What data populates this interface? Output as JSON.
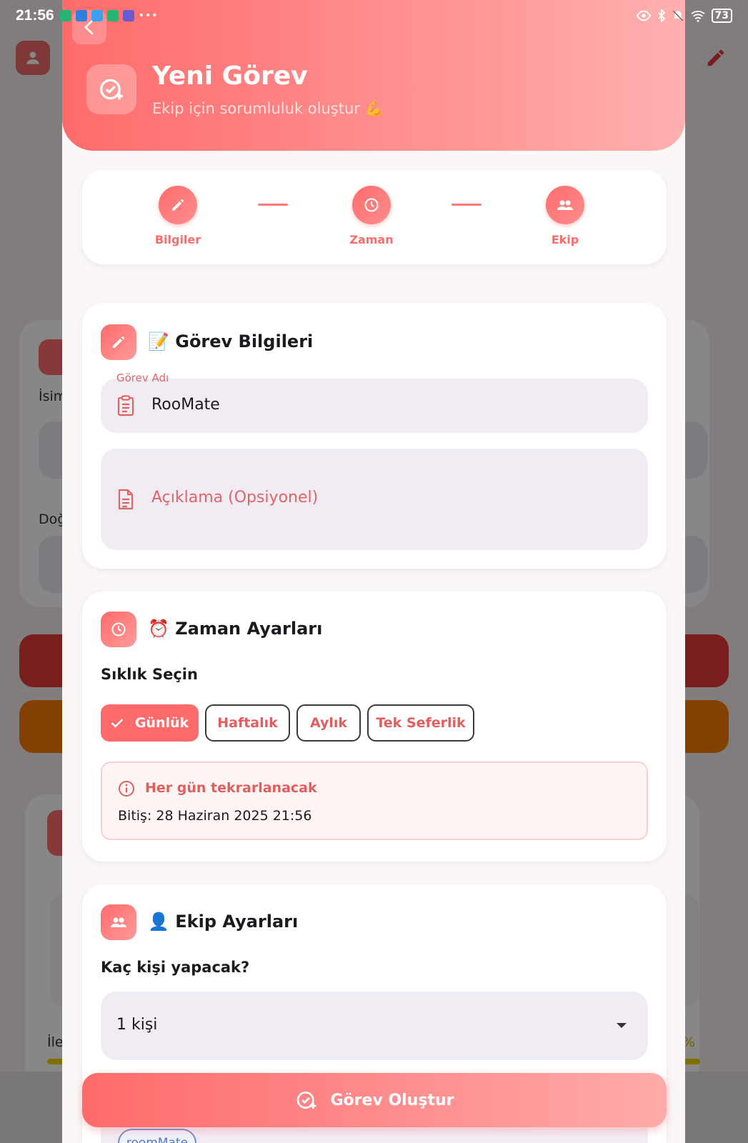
{
  "status_bar": {
    "time": "21:56",
    "battery": "73"
  },
  "background": {
    "label_name": "İsim",
    "label_birth": "Doğ",
    "label_progress": "İle",
    "progress_percent": "%"
  },
  "header": {
    "title": "Yeni Görev",
    "subtitle": "Ekip için sorumluluk oluştur 💪"
  },
  "stepper": {
    "steps": [
      {
        "label": "Bilgiler",
        "icon": "pencil-icon"
      },
      {
        "label": "Zaman",
        "icon": "clock-icon"
      },
      {
        "label": "Ekip",
        "icon": "group-icon"
      }
    ]
  },
  "task_info": {
    "title": "📝 Görev Bilgileri",
    "name_label": "Görev Adı",
    "name_value": "RooMate",
    "description_placeholder": "Açıklama (Opsiyonel)"
  },
  "time_settings": {
    "title": "⏰ Zaman Ayarları",
    "frequency_label": "Sıklık Seçin",
    "options": [
      "Günlük",
      "Haftalık",
      "Aylık",
      "Tek Seferlik"
    ],
    "selected": "Günlük",
    "info_title": "Her gün tekrarlanacak",
    "info_end": "Bitiş: 28 Haziran 2025 21:56"
  },
  "team_settings": {
    "title": "👤 Ekip Ayarları",
    "count_label": "Kaç kişi yapacak?",
    "count_value": "1 kişi",
    "member_chip": "roomMate"
  },
  "cta": {
    "label": "Görev Oluştur"
  },
  "colors": {
    "accent": "#ff6b6b",
    "accent_light": "#ffaaaa",
    "field_bg": "#f1ecf4"
  }
}
